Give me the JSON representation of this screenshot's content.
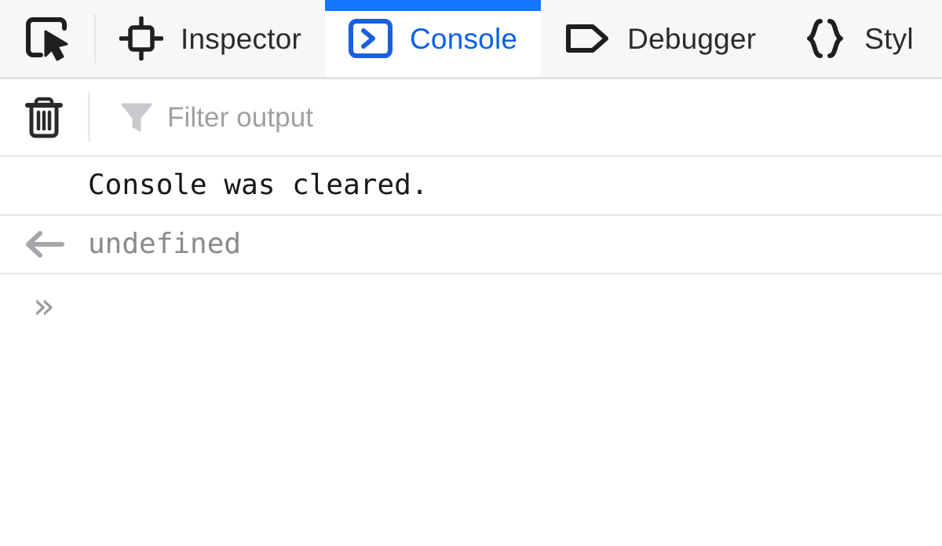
{
  "toolbar": {
    "picker_icon": "element-picker-icon",
    "tabs": [
      {
        "id": "inspector",
        "label": "Inspector",
        "icon": "inspector-target-icon",
        "active": false
      },
      {
        "id": "console",
        "label": "Console",
        "icon": "console-chevron-icon",
        "active": true
      },
      {
        "id": "debugger",
        "label": "Debugger",
        "icon": "debugger-tag-icon",
        "active": false
      },
      {
        "id": "style-editor",
        "label": "Styl",
        "icon": "style-editor-braces-icon",
        "active": false
      }
    ],
    "active_tab": "Console",
    "accent_color": "#1476ff",
    "active_tab_text_color": "#0b60e8"
  },
  "filterbar": {
    "clear_icon": "trash-icon",
    "clear_title": "Clear console output",
    "filter_icon": "filter-funnel-icon",
    "filter_value": "",
    "filter_placeholder": "Filter output"
  },
  "console": {
    "messages": [
      {
        "kind": "info",
        "gutter_icon": "",
        "text": "Console was cleared.",
        "color": "#18181b"
      },
      {
        "kind": "result",
        "gutter_icon": "return-arrow-icon",
        "text": "undefined",
        "color": "#8a8a8e"
      }
    ],
    "prompt": {
      "caret": "»",
      "caret_icon": "double-chevron-right-icon",
      "value": "",
      "placeholder": ""
    }
  }
}
